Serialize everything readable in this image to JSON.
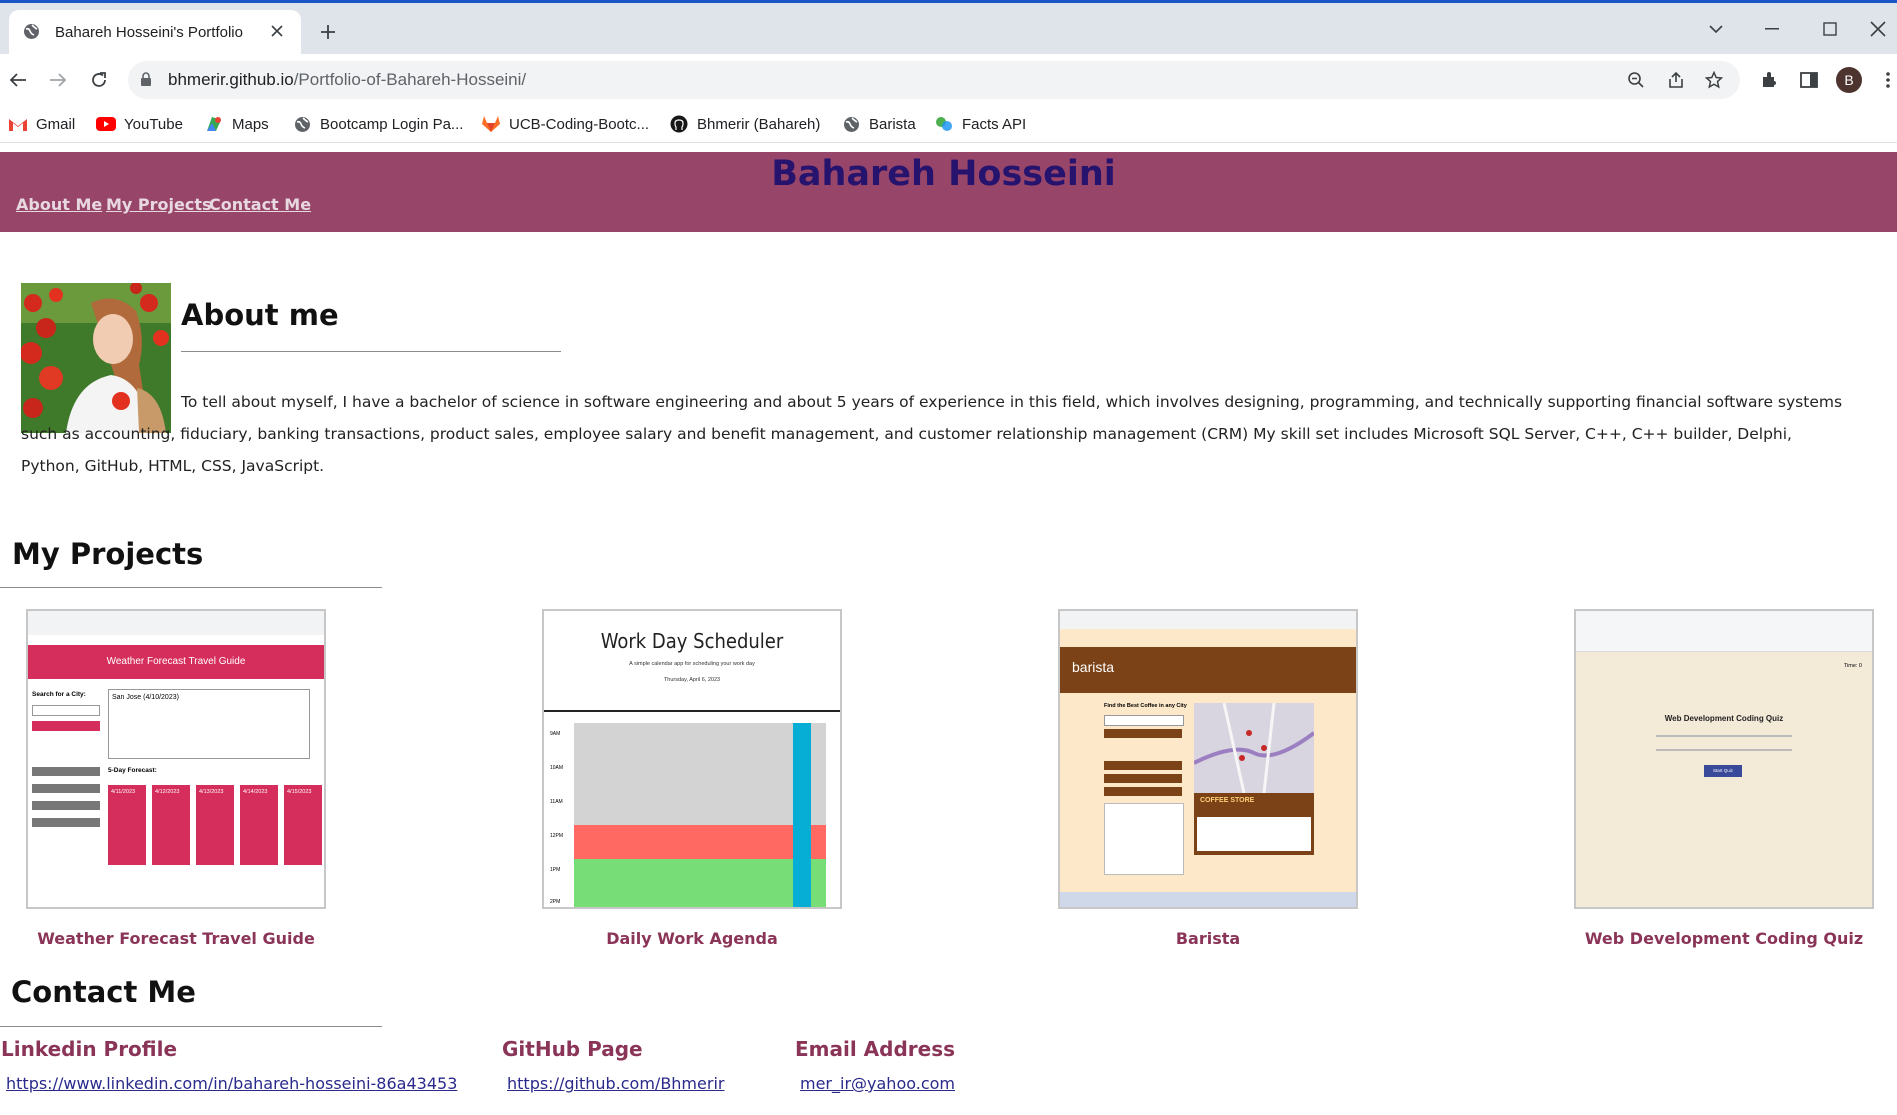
{
  "browser": {
    "tab_title": "Bahareh Hosseini's Portfolio",
    "url_host": "bhmerir.github.io",
    "url_path": "/Portfolio-of-Bahareh-Hosseini/",
    "profile_initial": "B",
    "bookmarks": [
      {
        "label": "Gmail",
        "icon": "gmail-icon"
      },
      {
        "label": "YouTube",
        "icon": "youtube-icon"
      },
      {
        "label": "Maps",
        "icon": "maps-icon"
      },
      {
        "label": "Bootcamp Login Pa...",
        "icon": "globe-icon"
      },
      {
        "label": "UCB-Coding-Bootc...",
        "icon": "gitlab-icon"
      },
      {
        "label": "Bhmerir (Bahareh)",
        "icon": "github-icon"
      },
      {
        "label": "Barista",
        "icon": "globe-icon"
      },
      {
        "label": "Facts API",
        "icon": "facts-icon"
      }
    ]
  },
  "header": {
    "title": "Bahareh Hosseini",
    "nav": [
      "About Me",
      "My Projects",
      "Contact Me"
    ]
  },
  "about": {
    "heading": "About me",
    "text": "To tell about myself, I have a bachelor of science in software engineering and about 5 years of experience in this field, which involves designing, programming, and technically supporting financial software systems such as accounting, fiduciary, banking transactions, product sales, employee salary and benefit management, and customer relationship management (CRM) My skill set includes Microsoft SQL Server, C++, C++ builder, Delphi, Python, GitHub, HTML, CSS, JavaScript."
  },
  "projects": {
    "heading": "My Projects",
    "items": [
      {
        "label": "Weather Forecast Travel Guide",
        "thumb_title": "Weather Forecast Travel Guide",
        "thumb_search": "Search for a City:",
        "thumb_city": "San Jose (4/10/2023)",
        "thumb_forecast": "5-Day Forecast:",
        "thumb_days": [
          "4/11/2023",
          "4/12/2023",
          "4/13/2023",
          "4/14/2023",
          "4/15/2023"
        ]
      },
      {
        "label": "Daily Work Agenda",
        "thumb_title": "Work Day Scheduler",
        "thumb_sub": "A simple calendar app for scheduling your work day",
        "thumb_date": "Thursday, April 6, 2023",
        "thumb_hours": [
          "9AM",
          "10AM",
          "11AM",
          "12PM",
          "1PM",
          "2PM"
        ]
      },
      {
        "label": "Barista",
        "thumb_brand": "barista",
        "thumb_find": "Find the Best Coffee in any City",
        "thumb_banner": "COFFEE STORE"
      },
      {
        "label": "Web Development Coding Quiz",
        "thumb_title": "Web Development Coding Quiz",
        "thumb_time": "Time: 0",
        "thumb_btn": "Start Quiz"
      }
    ]
  },
  "contact": {
    "heading": "Contact Me",
    "linkedin_heading": "Linkedin Profile",
    "linkedin_url": "https://www.linkedin.com/in/bahareh-hosseini-86a43453",
    "github_heading": "GitHub Page",
    "github_url": "https://github.com/Bhmerir",
    "email_heading": "Email Address",
    "email": "mer_ir@yahoo.com"
  },
  "colors": {
    "header_bg": "#97466a",
    "title": "#25136e",
    "accent_text": "#8a3457",
    "link": "#2a2a8c"
  }
}
